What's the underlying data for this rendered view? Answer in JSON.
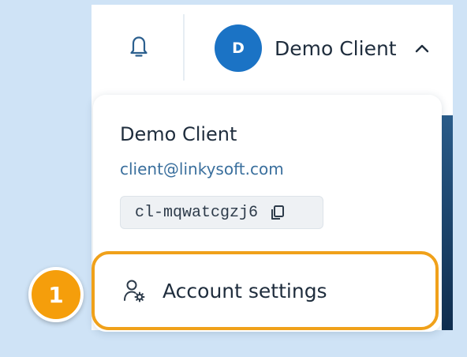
{
  "header": {
    "user_initial": "D",
    "user_name": "Demo Client",
    "bell_icon": "bell-icon",
    "chevron_icon": "chevron-up-icon"
  },
  "dropdown": {
    "name": "Demo Client",
    "email": "client@linkysoft.com",
    "client_id": "cl-mqwatcgzj6",
    "copy_icon": "copy-icon",
    "menu_items": [
      {
        "label": "Account settings",
        "icon": "user-gear-icon"
      }
    ]
  },
  "annotation": {
    "step_number": "1",
    "highlight_color": "#f0a11a",
    "badge_color": "#f59e0b"
  },
  "colors": {
    "avatar": "#1b73c5",
    "background": "#cfe3f6",
    "email_text": "#3a6f9d"
  }
}
